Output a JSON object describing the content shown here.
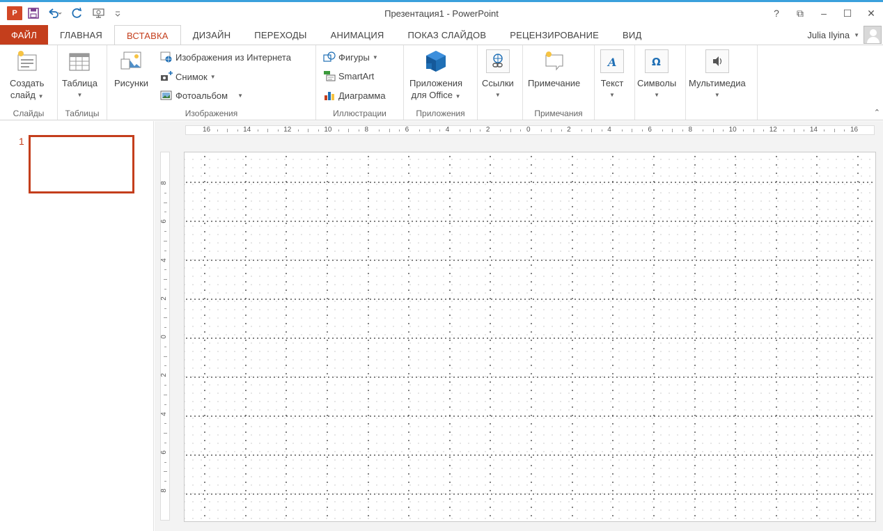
{
  "titlebar": {
    "title": "Презентация1 - PowerPoint",
    "logo_text": "P",
    "qat_icons": [
      "save-icon",
      "undo-icon",
      "redo-icon",
      "slideshow-icon",
      "customize-icon"
    ],
    "window_buttons": [
      "?",
      "⧉",
      "–",
      "☐",
      "✕"
    ]
  },
  "tabs": [
    {
      "label": "ФАЙЛ"
    },
    {
      "label": "ГЛАВНАЯ"
    },
    {
      "label": "ВСТАВКА"
    },
    {
      "label": "ДИЗАЙН"
    },
    {
      "label": "ПЕРЕХОДЫ"
    },
    {
      "label": "АНИМАЦИЯ"
    },
    {
      "label": "ПОКАЗ СЛАЙДОВ"
    },
    {
      "label": "РЕЦЕНЗИРОВАНИЕ"
    },
    {
      "label": "ВИД"
    }
  ],
  "account": {
    "user": "Julia Ilyina"
  },
  "ribbon": {
    "slides": {
      "label": "Слайды",
      "new_slide_line1": "Создать",
      "new_slide_line2": "слайд"
    },
    "tables": {
      "label": "Таблицы",
      "table": "Таблица"
    },
    "images": {
      "label": "Изображения",
      "pictures": "Рисунки",
      "online": "Изображения из Интернета",
      "screenshot": "Снимок",
      "album": "Фотоальбом"
    },
    "illustrations": {
      "label": "Иллюстрации",
      "shapes": "Фигуры",
      "smartart": "SmartArt",
      "chart": "Диаграмма"
    },
    "apps": {
      "label": "Приложения",
      "line1": "Приложения",
      "line2": "для Office"
    },
    "links": {
      "label": "Ссылки"
    },
    "comments": {
      "label": "Примечания",
      "comment": "Примечание"
    },
    "text": {
      "label": "Текст"
    },
    "symbols": {
      "label": "Символы"
    },
    "media": {
      "label": "Мультимедиа"
    },
    "colors": {
      "accent": "#c43e1c",
      "blue": "#1f6fb5"
    }
  },
  "slides_pane": {
    "slide_number": "1"
  },
  "rulers": {
    "horizontal": [
      "16",
      "14",
      "12",
      "10",
      "8",
      "6",
      "4",
      "2",
      "0",
      "2",
      "4",
      "6",
      "8",
      "10",
      "12",
      "14",
      "16"
    ],
    "vertical": [
      "8",
      "6",
      "4",
      "2",
      "0",
      "2",
      "4",
      "6",
      "8"
    ]
  }
}
